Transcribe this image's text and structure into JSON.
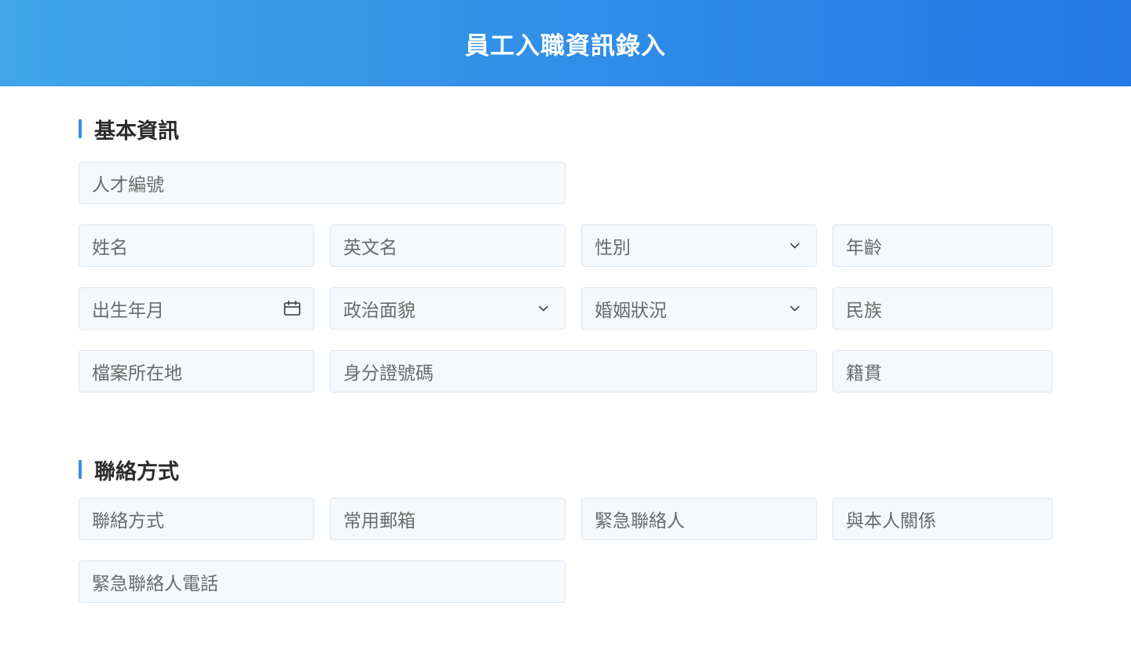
{
  "header": {
    "title": "員工入職資訊錄入"
  },
  "basic": {
    "section_title": "基本資訊",
    "talent_id": "人才編號",
    "name": "姓名",
    "english_name": "英文名",
    "gender": "性別",
    "age": "年齡",
    "birth_month": "出生年月",
    "political_status": "政治面貌",
    "marital_status": "婚姻狀況",
    "ethnicity": "民族",
    "file_location": "檔案所在地",
    "id_number": "身分證號碼",
    "native_place": "籍貫"
  },
  "contact": {
    "section_title": "聯絡方式",
    "contact_method": "聯絡方式",
    "email": "常用郵箱",
    "emergency_contact": "緊急聯絡人",
    "relationship": "與本人關係",
    "emergency_phone": "緊急聯絡人電話"
  },
  "icons": {
    "calendar": "calendar-icon",
    "dropdown": "chevron-down-icon"
  },
  "colors": {
    "header_gradient_start": "#3ea6e9",
    "header_gradient_end": "#2479e6",
    "accent_bar": "#3a8ee6",
    "field_background": "#f6f9fc",
    "field_border": "#dde5ee"
  }
}
